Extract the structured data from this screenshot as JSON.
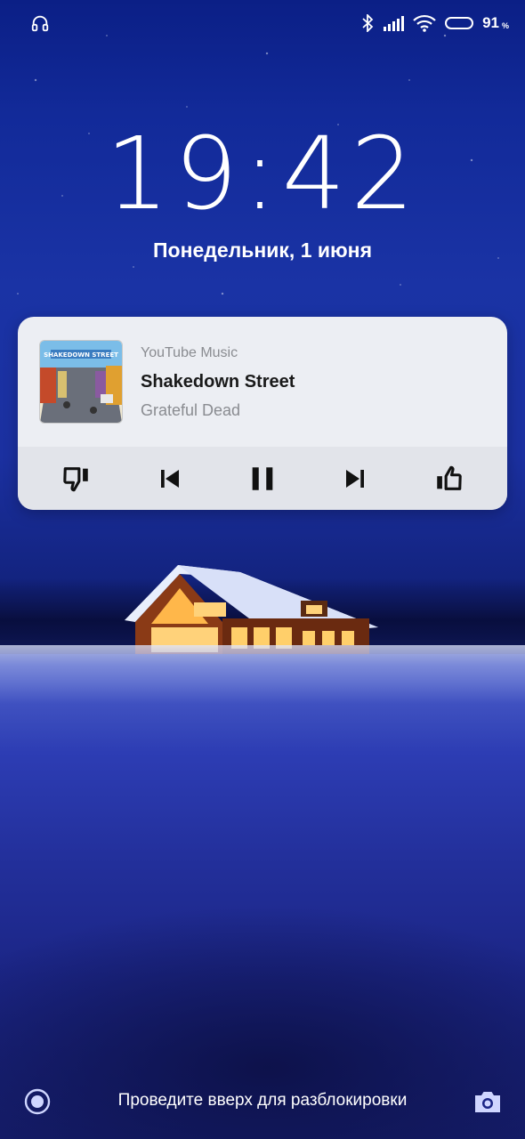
{
  "status_bar": {
    "left_icon": "headphones-icon",
    "bluetooth_icon": "bluetooth-icon",
    "signal_icon": "cellular-signal-icon",
    "wifi_icon": "wifi-icon",
    "battery_level": "91",
    "battery_unit": "%"
  },
  "lockscreen": {
    "time": "19:42",
    "date": "Понедельник, 1 июня",
    "unlock_hint": "Проведите вверх для разблокировки",
    "assistant_icon": "assistant-circle-icon",
    "camera_icon": "camera-icon"
  },
  "media": {
    "app_name": "YouTube Music",
    "title": "Shakedown Street",
    "artist": "Grateful Dead",
    "album_art_text": "SHAKEDOWN STREET",
    "controls": {
      "dislike_icon": "thumbs-down-icon",
      "previous_icon": "skip-previous-icon",
      "pause_icon": "pause-icon",
      "next_icon": "skip-next-icon",
      "like_icon": "thumbs-up-icon"
    }
  },
  "colors": {
    "card_bg": "#eceef3",
    "controls_bg": "#e2e4ea",
    "text_primary": "#1a1a1a",
    "text_secondary": "#8a8c91",
    "wallpaper_blue": "#1a33a5"
  }
}
